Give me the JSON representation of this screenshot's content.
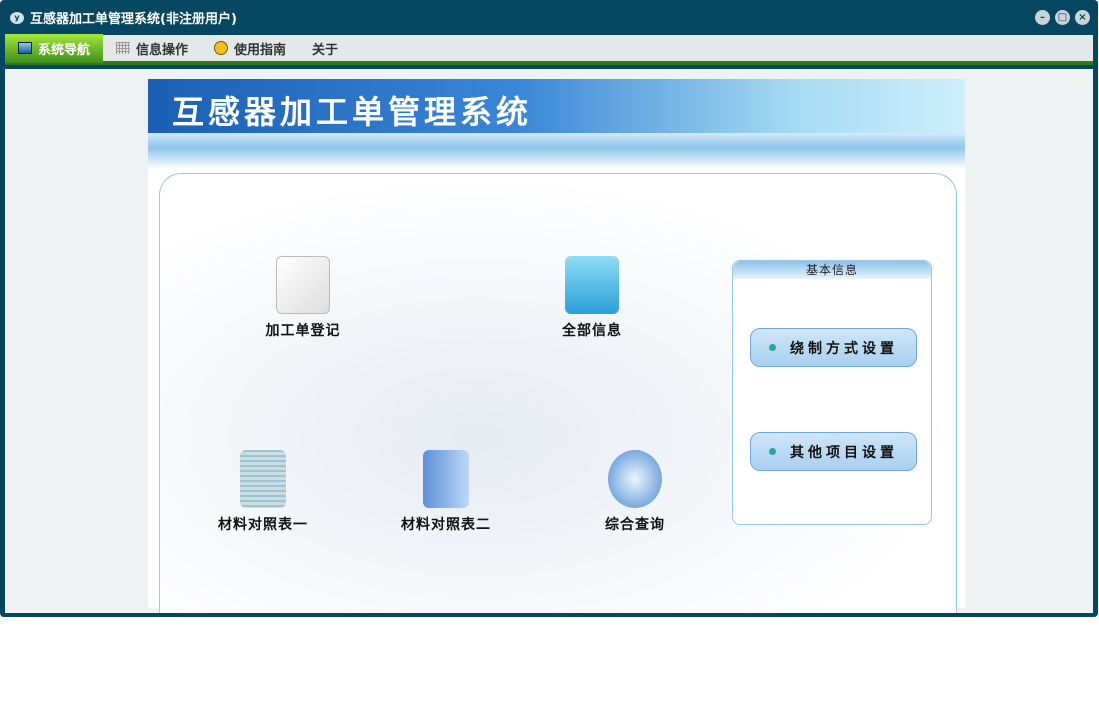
{
  "window": {
    "title": "互感器加工单管理系统(非注册用户)",
    "controls": [
      "minimize",
      "restore",
      "close"
    ]
  },
  "menu": [
    {
      "label": "系统导航",
      "icon": "monitor-icon",
      "active": true
    },
    {
      "label": "信息操作",
      "icon": "grid-icon"
    },
    {
      "label": "使用指南",
      "icon": "help-icon"
    },
    {
      "label": "关于"
    }
  ],
  "banner": {
    "title": "互感器加工单管理系统"
  },
  "items": [
    {
      "label": "加工单登记",
      "icon": "pencil-note-icon"
    },
    {
      "label": "全部信息",
      "icon": "folder-icon"
    },
    {
      "label": "材料对照表一",
      "icon": "document-icon"
    },
    {
      "label": "材料对照表二",
      "icon": "stacked-documents-icon"
    },
    {
      "label": "综合查询",
      "icon": "magnifier-icon"
    }
  ],
  "side": {
    "header": "基本信息",
    "buttons": [
      "绕制方式设置",
      "其他项目设置"
    ]
  }
}
